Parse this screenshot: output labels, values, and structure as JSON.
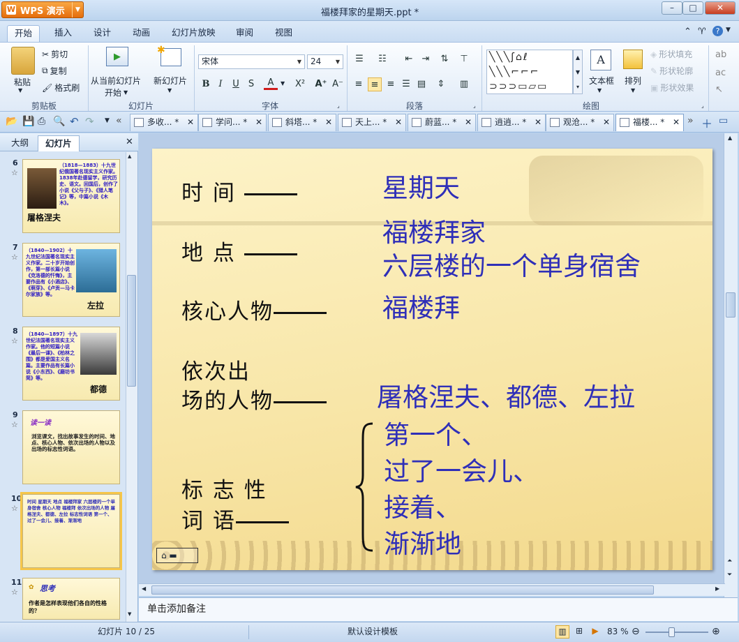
{
  "app": {
    "name": "WPS 演示",
    "doc_title": "福楼拜家的星期天.ppt *"
  },
  "window": {
    "minimize": "–",
    "restore": "□",
    "close": "✕"
  },
  "menu": {
    "tabs": [
      "开始",
      "插入",
      "设计",
      "动画",
      "幻灯片放映",
      "审阅",
      "视图"
    ],
    "active": "开始"
  },
  "ribbon": {
    "clipboard": {
      "paste": "粘贴",
      "cut": "剪切",
      "copy": "复制",
      "format_painter": "格式刷",
      "label": "剪贴板"
    },
    "slides": {
      "from_current": "从当前幻灯片",
      "start": "开始",
      "new_slide": "新幻灯片",
      "label": "幻灯片"
    },
    "font": {
      "name": "宋体",
      "size": "24",
      "bold": "B",
      "italic": "I",
      "underline": "U",
      "shadow": "S",
      "color": "A",
      "superscript": "X²",
      "grow": "A⁺",
      "shrink": "A⁻",
      "label": "字体"
    },
    "paragraph": {
      "label": "段落"
    },
    "drawing": {
      "textbox": "文本框",
      "arrange": "排列",
      "shape_fill": "形状填充",
      "shape_outline": "形状轮廓",
      "shape_effect": "形状效果",
      "label": "绘图"
    }
  },
  "doc_tabs": [
    {
      "label": "多收... *"
    },
    {
      "label": "学问... *"
    },
    {
      "label": "斜塔... *"
    },
    {
      "label": "天上... *"
    },
    {
      "label": "蔚蓝... *"
    },
    {
      "label": "逍逍... *"
    },
    {
      "label": "观沧... *"
    },
    {
      "label": "福楼... *"
    }
  ],
  "left_panel": {
    "tabs": [
      "大纲",
      "幻灯片"
    ],
    "active_tab": "幻灯片",
    "slides": [
      {
        "num": "6",
        "caption": "屠格涅夫",
        "text": "（1818—1883）十九世纪俄国著名现实主义作家。1838年赴德留学，研究历史、语文。回国后，创作了小说《父与子》、《猎人笔记》等，中篇小说《木木》。"
      },
      {
        "num": "7",
        "caption": "左拉",
        "text": "（1840—1902）十九世纪法国著名现实主义作家。二十岁开始创作，第一部长篇小说《克洛德的忏悔》，主要作品有《小酒店》、《萌芽》、《卢贡—马卡尔家族》等。"
      },
      {
        "num": "8",
        "caption": "都德",
        "text": "（1840—1897）十九世纪法国著名现实主义作家。他的短篇小说《最后一课》、《柏林之围》都是爱国主义名篇。主要作品有长篇小说《小东西》、《磨坊书简》等。"
      },
      {
        "num": "9",
        "heading": "读一读",
        "text": "浏览课文，找出故事发生的时间、地点、核心人物、依次出场的人物以及出场的标志性词语。"
      },
      {
        "num": "10",
        "text": "时间 星期天 地点 福楼拜家 六层楼的一个单身宿舍 核心人物 福楼拜 依次出场的人物 屠格涅夫、都德、左拉 标志性词语 第一个、过了一会儿、接着、渐渐地"
      },
      {
        "num": "11",
        "heading": "思考",
        "text": "作者是怎样表现他们各自的性格的？"
      }
    ]
  },
  "slide": {
    "labels": {
      "time": "时    间",
      "place": "地    点",
      "core": "核心人物",
      "order1": "依次出",
      "order2": "场的人物",
      "marker1": "标 志 性",
      "marker2": "词    语"
    },
    "values": {
      "time": "星期天",
      "place1": "福楼拜家",
      "place2": "六层楼的一个单身宿舍",
      "core": "福楼拜",
      "order": "屠格涅夫、都德、左拉",
      "marker1": "第一个、",
      "marker2": "过了一会儿、",
      "marker3": "接着、",
      "marker4": "渐渐地"
    }
  },
  "notes_placeholder": "单击添加备注",
  "status": {
    "slide_info": "幻灯片 10 / 25",
    "template": "默认设计模板",
    "zoom": "83 %"
  },
  "colors": {
    "slide_text_blue": "#2f2fb8",
    "accent_orange": "#e56d0c"
  }
}
